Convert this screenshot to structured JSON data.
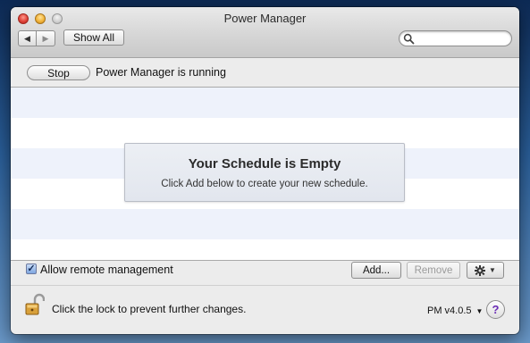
{
  "window": {
    "title": "Power Manager"
  },
  "toolbar": {
    "back_icon": "chevron-left-icon",
    "forward_icon": "chevron-right-icon",
    "show_all_label": "Show All",
    "search_placeholder": "",
    "search_value": ""
  },
  "status": {
    "stop_label": "Stop",
    "text": "Power Manager is running"
  },
  "schedule": {
    "empty_title": "Your Schedule is Empty",
    "empty_subtitle": "Click Add below to create your new schedule."
  },
  "footer": {
    "remote_management_label": "Allow remote management",
    "remote_management_checked": true,
    "add_label": "Add...",
    "remove_label": "Remove",
    "remove_enabled": false,
    "lock_text": "Click the lock to prevent further changes.",
    "version_label": "PM v4.0.5",
    "help_label": "?"
  },
  "colors": {
    "stripe": "#eef2fb",
    "help_accent": "#6a2bb5",
    "traffic_close": "#e0443a",
    "traffic_min": "#f2b43b",
    "traffic_max": "#cfcfcf"
  }
}
